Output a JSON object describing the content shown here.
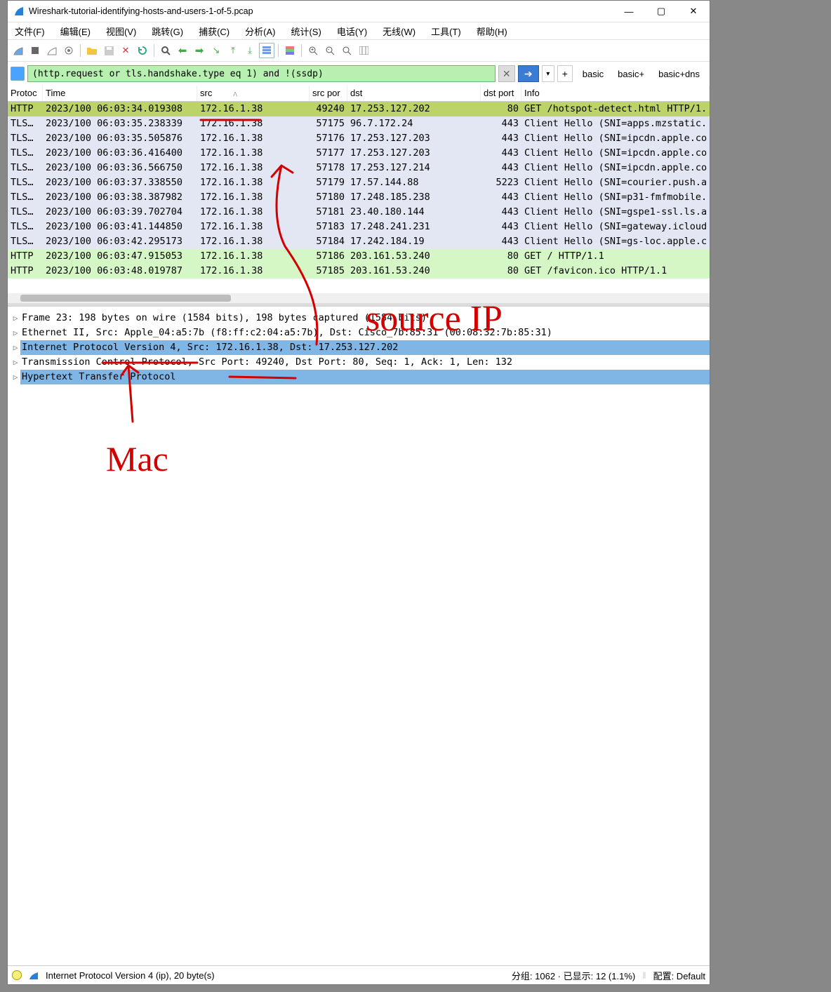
{
  "window": {
    "title": "Wireshark-tutorial-identifying-hosts-and-users-1-of-5.pcap",
    "min": "—",
    "max": "▢",
    "close": "✕"
  },
  "menu": [
    "文件(F)",
    "编辑(E)",
    "视图(V)",
    "跳转(G)",
    "捕获(C)",
    "分析(A)",
    "统计(S)",
    "电话(Y)",
    "无线(W)",
    "工具(T)",
    "帮助(H)"
  ],
  "filter": {
    "text": "(http.request or tls.handshake.type eq 1) and !(ssdp)",
    "buttons": [
      "basic",
      "basic+",
      "basic+dns"
    ],
    "clear": "✕",
    "go": "➔",
    "plus": "+",
    "dd": "▾"
  },
  "columns": {
    "proto": "Protoc",
    "time": "Time",
    "src": "src",
    "sport": "src por",
    "dst": "dst",
    "dport": "dst port",
    "info": "Info"
  },
  "packets": [
    {
      "proto": "HTTP",
      "time": "2023/100 06:03:34.019308",
      "src": "172.16.1.38",
      "sport": "49240",
      "dst": "17.253.127.202",
      "dport": "80",
      "info": "GET /hotspot-detect.html HTTP/1.",
      "cls": "sel"
    },
    {
      "proto": "TLS…",
      "time": "2023/100 06:03:35.238339",
      "src": "172.16.1.38",
      "sport": "57175",
      "dst": "96.7.172.24",
      "dport": "443",
      "info": "Client Hello (SNI=apps.mzstatic.",
      "cls": "tls"
    },
    {
      "proto": "TLS…",
      "time": "2023/100 06:03:35.505876",
      "src": "172.16.1.38",
      "sport": "57176",
      "dst": "17.253.127.203",
      "dport": "443",
      "info": "Client Hello (SNI=ipcdn.apple.co",
      "cls": "tls"
    },
    {
      "proto": "TLS…",
      "time": "2023/100 06:03:36.416400",
      "src": "172.16.1.38",
      "sport": "57177",
      "dst": "17.253.127.203",
      "dport": "443",
      "info": "Client Hello (SNI=ipcdn.apple.co",
      "cls": "tls"
    },
    {
      "proto": "TLS…",
      "time": "2023/100 06:03:36.566750",
      "src": "172.16.1.38",
      "sport": "57178",
      "dst": "17.253.127.214",
      "dport": "443",
      "info": "Client Hello (SNI=ipcdn.apple.co",
      "cls": "tls"
    },
    {
      "proto": "TLS…",
      "time": "2023/100 06:03:37.338550",
      "src": "172.16.1.38",
      "sport": "57179",
      "dst": "17.57.144.88",
      "dport": "5223",
      "info": "Client Hello (SNI=courier.push.a",
      "cls": "tls"
    },
    {
      "proto": "TLS…",
      "time": "2023/100 06:03:38.387982",
      "src": "172.16.1.38",
      "sport": "57180",
      "dst": "17.248.185.238",
      "dport": "443",
      "info": "Client Hello (SNI=p31-fmfmobile.",
      "cls": "tls"
    },
    {
      "proto": "TLS…",
      "time": "2023/100 06:03:39.702704",
      "src": "172.16.1.38",
      "sport": "57181",
      "dst": "23.40.180.144",
      "dport": "443",
      "info": "Client Hello (SNI=gspe1-ssl.ls.a",
      "cls": "tls"
    },
    {
      "proto": "TLS…",
      "time": "2023/100 06:03:41.144850",
      "src": "172.16.1.38",
      "sport": "57183",
      "dst": "17.248.241.231",
      "dport": "443",
      "info": "Client Hello (SNI=gateway.icloud",
      "cls": "tls"
    },
    {
      "proto": "TLS…",
      "time": "2023/100 06:03:42.295173",
      "src": "172.16.1.38",
      "sport": "57184",
      "dst": "17.242.184.19",
      "dport": "443",
      "info": "Client Hello (SNI=gs-loc.apple.c",
      "cls": "tls"
    },
    {
      "proto": "HTTP",
      "time": "2023/100 06:03:47.915053",
      "src": "172.16.1.38",
      "sport": "57186",
      "dst": "203.161.53.240",
      "dport": "80",
      "info": "GET / HTTP/1.1",
      "cls": "http"
    },
    {
      "proto": "HTTP",
      "time": "2023/100 06:03:48.019787",
      "src": "172.16.1.38",
      "sport": "57185",
      "dst": "203.161.53.240",
      "dport": "80",
      "info": "GET /favicon.ico HTTP/1.1",
      "cls": "http"
    }
  ],
  "details": {
    "frame": "Frame 23: 198 bytes on wire (1584 bits), 198 bytes captured (1584 bits)",
    "eth": "Ethernet II, Src: Apple_04:a5:7b (f8:ff:c2:04:a5:7b), Dst: Cisco_7b:85:31 (00:08:32:7b:85:31)",
    "ip": "Internet Protocol Version 4, Src: 172.16.1.38, Dst: 17.253.127.202",
    "tcp": "Transmission Control Protocol, Src Port: 49240, Dst Port: 80, Seq: 1, Ack: 1, Len: 132",
    "http": "Hypertext Transfer Protocol"
  },
  "status": {
    "left": "Internet Protocol Version 4 (ip), 20 byte(s)",
    "packets": "分组: 1062 · 已显示: 12 (1.1%)",
    "profile": "配置: Default"
  },
  "annotations": {
    "source_ip": "source IP",
    "mac": "Mac"
  }
}
